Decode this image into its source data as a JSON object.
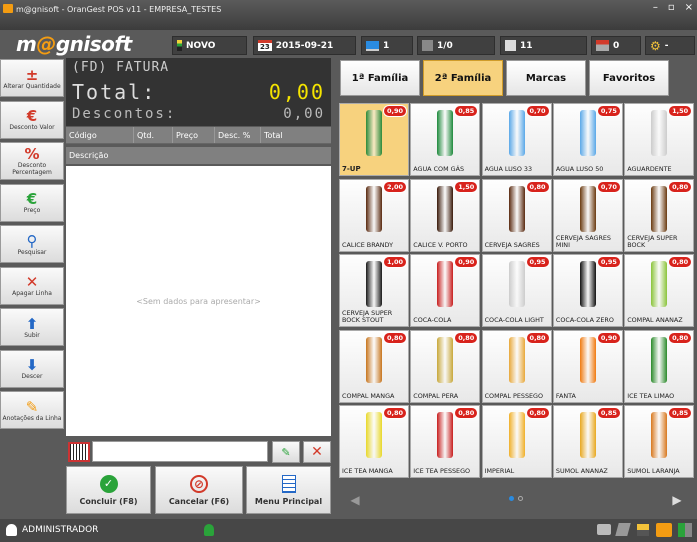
{
  "window": {
    "title": "m@gnisoft - OranGest POS v11 - EMPRESA_TESTES",
    "min": "–",
    "max": "▫",
    "close": "×"
  },
  "logo": {
    "m": "m",
    "at": "@",
    "rest": "gnisoft"
  },
  "toolbar": {
    "novo": "NOVO",
    "date_day": "23",
    "date": "2015-09-21",
    "terminal": "1",
    "pages": "1/0",
    "count": "11",
    "zero": "0",
    "settings": "-"
  },
  "sidebar": [
    {
      "label": "Alterar Quantidade",
      "icon": "±"
    },
    {
      "label": "Desconto Valor",
      "icon": "€"
    },
    {
      "label": "Desconto Percentagem",
      "icon": "%"
    },
    {
      "label": "Preço",
      "icon": "€"
    },
    {
      "label": "Pesquisar",
      "icon": "⚲"
    },
    {
      "label": "Apagar Linha",
      "icon": "✕"
    },
    {
      "label": "Subir",
      "icon": "⬆"
    },
    {
      "label": "Descer",
      "icon": "⬇"
    },
    {
      "label": "Anotações da Linha",
      "icon": "✎"
    }
  ],
  "lcd": {
    "doc": "(FD) FATURA",
    "total_label": "Total:",
    "total_value": "0,00",
    "desc_label": "Descontos:",
    "desc_value": "0,00"
  },
  "grid": {
    "columns": [
      "Código",
      "Qtd.",
      "Preço",
      "Desc. %",
      "Total"
    ],
    "sub": "Descrição",
    "empty": "<Sem dados para apresentar>"
  },
  "bottom": {
    "conclude": "Concluir (F8)",
    "cancel": "Cancelar (F6)",
    "menu": "Menu Principal"
  },
  "categories": [
    "1ª Família",
    "2ª Família",
    "Marcas",
    "Favoritos"
  ],
  "products": [
    {
      "name": "7-UP",
      "price": "0,90"
    },
    {
      "name": "AGUA COM GÁS",
      "price": "0,85"
    },
    {
      "name": "AGUA LUSO 33",
      "price": "0,70"
    },
    {
      "name": "AGUA LUSO 50",
      "price": "0,75"
    },
    {
      "name": "AGUARDENTE",
      "price": "1,50"
    },
    {
      "name": "CALICE BRANDY",
      "price": "2,00"
    },
    {
      "name": "CALICE V. PORTO",
      "price": "1,50"
    },
    {
      "name": "CERVEJA SAGRES",
      "price": "0,80"
    },
    {
      "name": "CERVEJA SAGRES MINI",
      "price": "0,70"
    },
    {
      "name": "CERVEJA SUPER BOCK",
      "price": "0,80"
    },
    {
      "name": "CERVEJA SUPER BOCK STOUT",
      "price": "1,00"
    },
    {
      "name": "COCA-COLA",
      "price": "0,90"
    },
    {
      "name": "COCA-COLA LIGHT",
      "price": "0,95"
    },
    {
      "name": "COCA-COLA ZERO",
      "price": "0,95"
    },
    {
      "name": "COMPAL ANANAZ",
      "price": "0,80"
    },
    {
      "name": "COMPAL MANGA",
      "price": "0,80"
    },
    {
      "name": "COMPAL PERA",
      "price": "0,80"
    },
    {
      "name": "COMPAL PESSEGO",
      "price": "0,80"
    },
    {
      "name": "FANTA",
      "price": "0,90"
    },
    {
      "name": "ICE TEA LIMAO",
      "price": "0,80"
    },
    {
      "name": "ICE TEA MANGA",
      "price": "0,80"
    },
    {
      "name": "ICE TEA PESSEGO",
      "price": "0,80"
    },
    {
      "name": "IMPERIAL",
      "price": "0,80"
    },
    {
      "name": "SUMOL ANANAZ",
      "price": "0,85"
    },
    {
      "name": "SUMOL LARANJA",
      "price": "0,85"
    }
  ],
  "status": {
    "user": "ADMINISTRADOR"
  },
  "colors": {
    "accent": "#f39c12",
    "price_badge": "#d8231c",
    "active_tab": "#f7d27e",
    "lcd_value": "#f5e400"
  }
}
